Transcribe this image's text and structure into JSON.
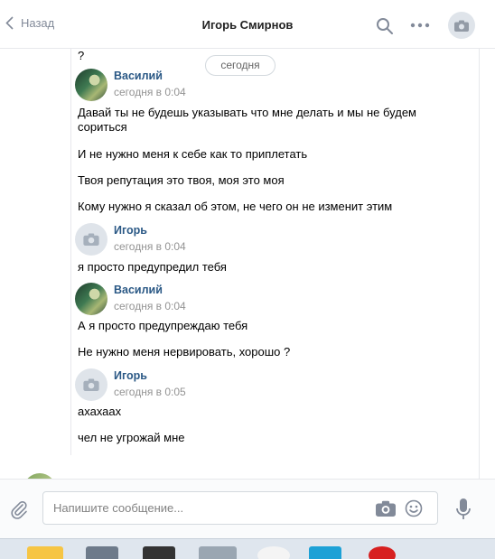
{
  "header": {
    "back_label": "Назад",
    "title": "Игорь Смирнов"
  },
  "chat": {
    "top_fragment": "?",
    "date_separator": "сегодня",
    "groups": [
      {
        "author": "Василий",
        "time": "сегодня в 0:04",
        "avatar": "photo",
        "lines": [
          "Давай ты не будешь указывать что мне делать и мы не будем сориться",
          "И не нужно меня к себе как то приплетать",
          "Твоя репутация это твоя, моя это моя",
          "Кому нужно я сказал об этом, не чего он не изменит этим"
        ]
      },
      {
        "author": "Игорь",
        "time": "сегодня в 0:04",
        "avatar": "camera",
        "lines": [
          "я просто предупредил тебя"
        ]
      },
      {
        "author": "Василий",
        "time": "сегодня в 0:04",
        "avatar": "photo",
        "lines": [
          "А я просто предупреждаю тебя",
          "Не нужно меня нервировать, хорошо ?"
        ]
      },
      {
        "author": "Игорь",
        "time": "сегодня в 0:05",
        "avatar": "camera",
        "lines": [
          "ахахаах",
          "чел не угрожай мне"
        ]
      }
    ]
  },
  "composer": {
    "placeholder": "Напишите сообщение..."
  },
  "icons": {
    "back": "chevron-left-icon",
    "search": "search-icon",
    "more": "more-dots-icon",
    "attach": "paperclip-icon",
    "camera": "camera-icon",
    "emoji": "smile-icon",
    "mic": "microphone-icon"
  },
  "colors": {
    "link": "#2a5885",
    "muted": "#939393",
    "icon": "#828a99",
    "border": "#e7e8ec"
  }
}
